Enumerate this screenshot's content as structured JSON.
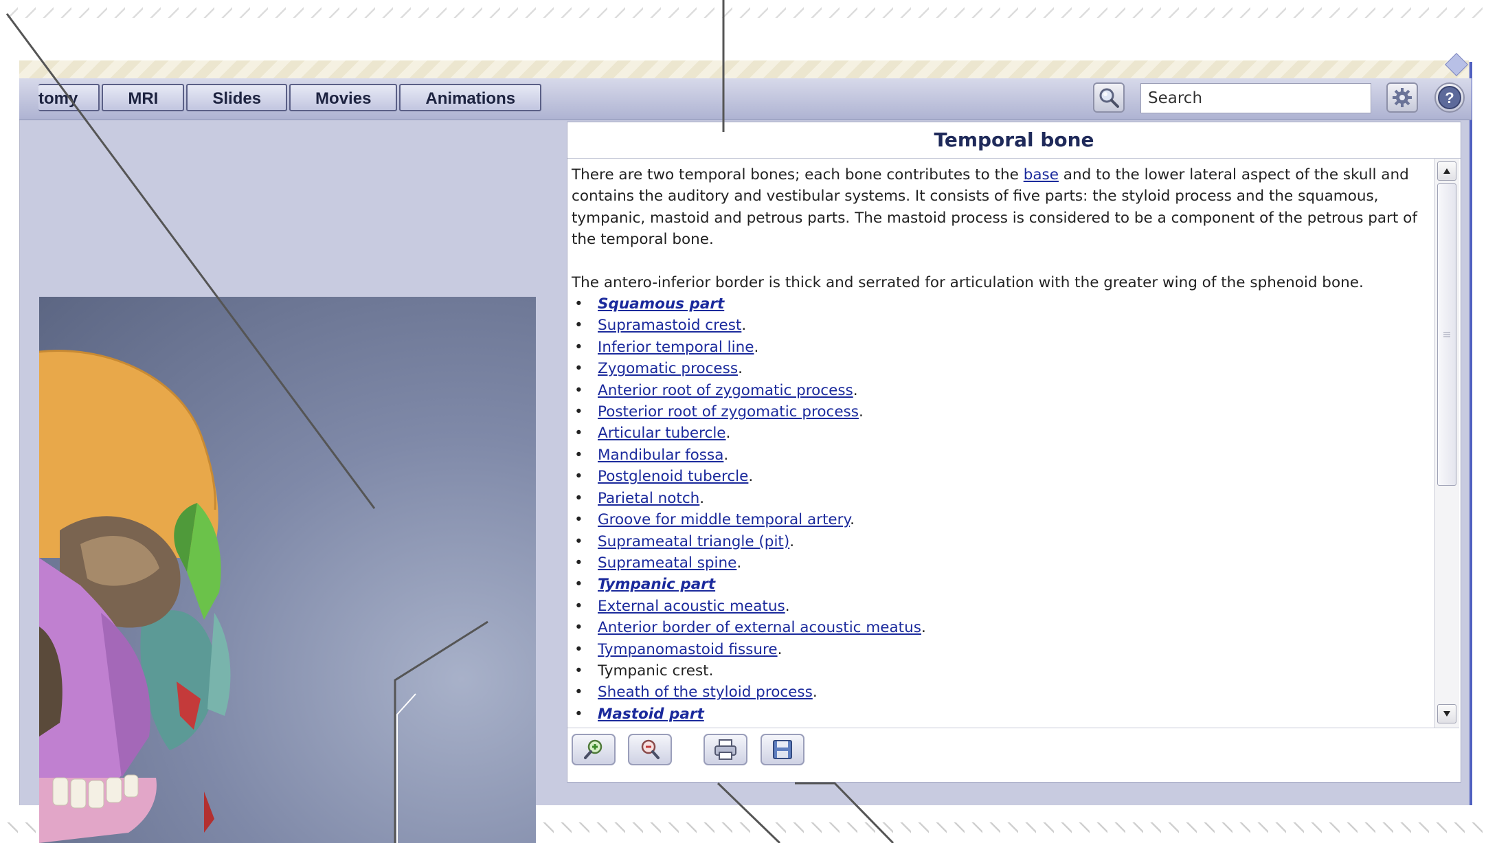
{
  "tabs": [
    {
      "label": "tomy"
    },
    {
      "label": "MRI"
    },
    {
      "label": "Slides"
    },
    {
      "label": "Movies"
    },
    {
      "label": "Animations"
    }
  ],
  "search": {
    "placeholder": "Search"
  },
  "icons": {
    "search": "magnifier-icon",
    "settings": "gear-icon",
    "help": "help-icon",
    "zoom_in": "zoom-in-icon",
    "zoom_out": "zoom-out-icon",
    "print": "print-icon",
    "save": "save-icon"
  },
  "panel": {
    "title": "Temporal bone",
    "intro_before_link": "There are two temporal bones; each bone contributes to the ",
    "intro_link": "base",
    "intro_after_link": " and to the lower lateral aspect of the skull and contains the auditory and vestibular systems. It consists of five parts: the styloid process and the squamous, tympanic, mastoid and petrous parts. The mastoid process is considered to be a component of the petrous part of the temporal bone.",
    "para2": "The antero-inferior border is thick and serrated for articulation with the greater wing of the sphenoid bone.",
    "items": [
      {
        "text": "Squamous part",
        "link": true,
        "bold": true,
        "suffix": ""
      },
      {
        "text": "Supramastoid crest",
        "link": true,
        "bold": false,
        "suffix": "."
      },
      {
        "text": "Inferior temporal line",
        "link": true,
        "bold": false,
        "suffix": "."
      },
      {
        "text": "Zygomatic process",
        "link": true,
        "bold": false,
        "suffix": "."
      },
      {
        "text": "Anterior root of zygomatic process",
        "link": true,
        "bold": false,
        "suffix": "."
      },
      {
        "text": "Posterior root of zygomatic process",
        "link": true,
        "bold": false,
        "suffix": "."
      },
      {
        "text": "Articular tubercle",
        "link": true,
        "bold": false,
        "suffix": "."
      },
      {
        "text": "Mandibular fossa",
        "link": true,
        "bold": false,
        "suffix": "."
      },
      {
        "text": "Postglenoid tubercle",
        "link": true,
        "bold": false,
        "suffix": "."
      },
      {
        "text": "Parietal notch",
        "link": true,
        "bold": false,
        "suffix": "."
      },
      {
        "text": "Groove for middle temporal artery",
        "link": true,
        "bold": false,
        "suffix": "."
      },
      {
        "text": "Suprameatal triangle (pit)",
        "link": true,
        "bold": false,
        "suffix": "."
      },
      {
        "text": "Suprameatal spine",
        "link": true,
        "bold": false,
        "suffix": "."
      },
      {
        "text": "Tympanic part",
        "link": true,
        "bold": true,
        "suffix": ""
      },
      {
        "text": "External acoustic meatus",
        "link": true,
        "bold": false,
        "suffix": "."
      },
      {
        "text": "Anterior border of external acoustic meatus",
        "link": true,
        "bold": false,
        "suffix": "."
      },
      {
        "text": "Tympanomastoid fissure",
        "link": true,
        "bold": false,
        "suffix": "."
      },
      {
        "text": "Tympanic crest.",
        "link": false,
        "bold": false,
        "suffix": ""
      },
      {
        "text": "Sheath of the styloid process",
        "link": true,
        "bold": false,
        "suffix": "."
      },
      {
        "text": "Mastoid part",
        "link": true,
        "bold": true,
        "suffix": ""
      }
    ]
  },
  "colors": {
    "link": "#1b2a9c",
    "toolbar": "#c0c4dc",
    "accent_border": "#5060c0"
  }
}
